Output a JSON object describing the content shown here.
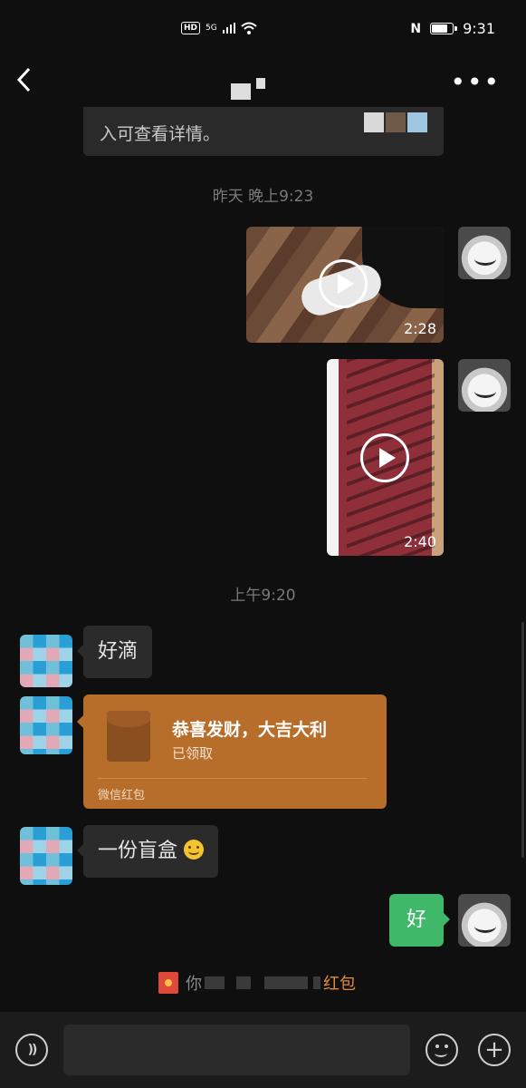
{
  "status_bar": {
    "hd": "HD",
    "signal": "5G",
    "nfc": "N",
    "battery_level": 0.85,
    "time": "9:31"
  },
  "nav": {
    "back_icon": "chevron-left-icon",
    "more_icon": "more-dots-icon",
    "more_glyph": "•••"
  },
  "messages": {
    "top_card": {
      "text": "入可查看详情。"
    },
    "time_1": "昨天 晚上9:23",
    "video_1": {
      "duration": "2:28"
    },
    "video_2": {
      "duration": "2:40"
    },
    "time_2": "上午9:20",
    "text_1": "好滴",
    "red_packet": {
      "title": "恭喜发财，大吉大利",
      "status": "已领取",
      "footer": "微信红包"
    },
    "text_2": "一份盲盒",
    "my_reply": "好",
    "system_note": {
      "prefix": "你",
      "link": "红包"
    }
  },
  "input_bar": {
    "voice_icon": "voice-icon",
    "emoji_icon": "emoji-icon",
    "plus_icon": "plus-icon",
    "plus_glyph": "+"
  },
  "colors": {
    "background": "#0f0f0f",
    "my_bubble": "#3fb86a",
    "red_packet": "#b86e2b",
    "link": "#e38b38"
  }
}
